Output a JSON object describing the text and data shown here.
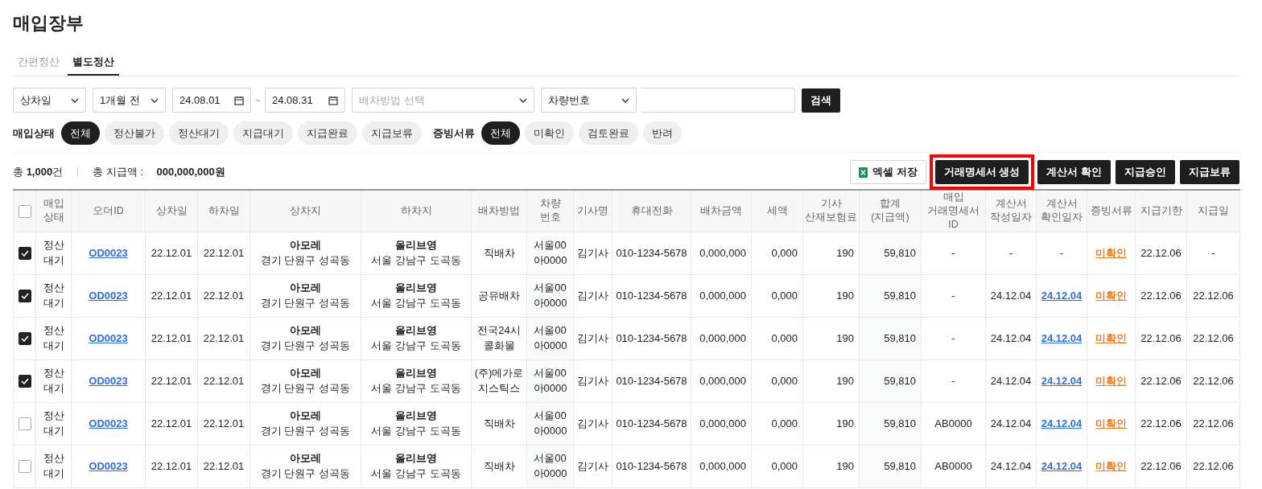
{
  "title": "매입장부",
  "tabs": [
    {
      "label": "간편정산",
      "selected": false
    },
    {
      "label": "별도정산",
      "selected": true
    }
  ],
  "filters": {
    "date_type": "상차일",
    "period": "1개월 전",
    "date_from": "24.08.01",
    "date_sep": "~",
    "date_to": "24.08.31",
    "dispatch_placeholder": "배차방법 선택",
    "search_type": "차량번호",
    "search_button": "검색"
  },
  "status_filter": {
    "label": "매입상태",
    "chips": [
      {
        "label": "전체",
        "selected": true
      },
      {
        "label": "정산불가",
        "selected": false
      },
      {
        "label": "정산대기",
        "selected": false
      },
      {
        "label": "지급대기",
        "selected": false
      },
      {
        "label": "지급완료",
        "selected": false
      },
      {
        "label": "지급보류",
        "selected": false
      }
    ]
  },
  "doc_filter": {
    "label": "증빙서류",
    "chips": [
      {
        "label": "전체",
        "selected": true
      },
      {
        "label": "미확인",
        "selected": false
      },
      {
        "label": "검토완료",
        "selected": false
      },
      {
        "label": "반려",
        "selected": false
      }
    ]
  },
  "summary": {
    "count": "총 **1,000**건",
    "total_label": "총 지급액 :",
    "total_value": "000,000,000원"
  },
  "actions": [
    {
      "label": "엑셀 저장",
      "kind": "excel",
      "highlighted": false
    },
    {
      "label": "거래명세서 생성",
      "kind": "dark",
      "highlighted": true
    },
    {
      "label": "계산서 확인",
      "kind": "dark",
      "highlighted": false
    },
    {
      "label": "지급승인",
      "kind": "dark",
      "highlighted": false
    },
    {
      "label": "지급보류",
      "kind": "dark",
      "highlighted": false
    }
  ],
  "table": {
    "all_checked": false,
    "columns": [
      "매입\n상태",
      "오더ID",
      "상차일",
      "하차일",
      "상차지",
      "하차지",
      "배차방법",
      "차량\n번호",
      "기사명",
      "휴대전화",
      "배차금액",
      "세액",
      "기사\n산재보험료",
      "합계\n(지급액)",
      "매입\n거래명세서ID",
      "계산서\n작성일자",
      "계산서\n확인일자",
      "증빙서류",
      "지급기한",
      "지급일"
    ],
    "rows": [
      {
        "checked": true,
        "status": "정산\n대기",
        "order_id": "OD0023",
        "load_date": "22.12.01",
        "unload_date": "22.12.01",
        "pickup": {
          "name": "아모레",
          "address": "경기 단원구 성곡동"
        },
        "dropoff": {
          "name": "올리브영",
          "address": "서울 강남구 도곡동"
        },
        "dispatch": "직배차",
        "vehicle": "서울00\n아0000",
        "driver": "김기사",
        "phone": "010-1234-5678",
        "amount": "0,000,000",
        "tax": "0,000",
        "insurance": "190",
        "total": "59,810",
        "invoice_id": "-",
        "issue_date": "-",
        "confirm_date": "-",
        "confirmed": false,
        "doc_status": "미확인",
        "due_date": "22.12.06",
        "pay_date": "-"
      },
      {
        "checked": true,
        "status": "정산\n대기",
        "order_id": "OD0023",
        "load_date": "22.12.01",
        "unload_date": "22.12.01",
        "pickup": {
          "name": "아모레",
          "address": "경기 단원구 성곡동"
        },
        "dropoff": {
          "name": "올리브영",
          "address": "서울 강남구 도곡동"
        },
        "dispatch": "공유배차",
        "vehicle": "서울00\n아0000",
        "driver": "김기사",
        "phone": "010-1234-5678",
        "amount": "0,000,000",
        "tax": "0,000",
        "insurance": "190",
        "total": "59,810",
        "invoice_id": "-",
        "issue_date": "24.12.04",
        "confirm_date": "24.12.04",
        "confirmed": true,
        "doc_status": "미확인",
        "due_date": "22.12.06",
        "pay_date": "22.12.06"
      },
      {
        "checked": true,
        "status": "정산\n대기",
        "order_id": "OD0023",
        "load_date": "22.12.01",
        "unload_date": "22.12.01",
        "pickup": {
          "name": "아모레",
          "address": "경기 단원구 성곡동"
        },
        "dropoff": {
          "name": "올리브영",
          "address": "서울 강남구 도곡동"
        },
        "dispatch": "전국24시\n콜화물",
        "vehicle": "서울00\n아0000",
        "driver": "김기사",
        "phone": "010-1234-5678",
        "amount": "0,000,000",
        "tax": "0,000",
        "insurance": "190",
        "total": "59,810",
        "invoice_id": "-",
        "issue_date": "24.12.04",
        "confirm_date": "24.12.04",
        "confirmed": true,
        "doc_status": "미확인",
        "due_date": "22.12.06",
        "pay_date": "22.12.06"
      },
      {
        "checked": true,
        "status": "정산\n대기",
        "order_id": "OD0023",
        "load_date": "22.12.01",
        "unload_date": "22.12.01",
        "pickup": {
          "name": "아모레",
          "address": "경기 단원구 성곡동"
        },
        "dropoff": {
          "name": "올리브영",
          "address": "서울 강남구 도곡동"
        },
        "dispatch": "(주)메가로\n지스틱스",
        "vehicle": "서울00\n아0000",
        "driver": "김기사",
        "phone": "010-1234-5678",
        "amount": "0,000,000",
        "tax": "0,000",
        "insurance": "190",
        "total": "59,810",
        "invoice_id": "-",
        "issue_date": "24.12.04",
        "confirm_date": "24.12.04",
        "confirmed": true,
        "doc_status": "미확인",
        "due_date": "22.12.06",
        "pay_date": "22.12.06"
      },
      {
        "checked": false,
        "status": "정산\n대기",
        "order_id": "OD0023",
        "load_date": "22.12.01",
        "unload_date": "22.12.01",
        "pickup": {
          "name": "아모레",
          "address": "경기 단원구 성곡동"
        },
        "dropoff": {
          "name": "올리브영",
          "address": "서울 강남구 도곡동"
        },
        "dispatch": "직배차",
        "vehicle": "서울00\n아0000",
        "driver": "김기사",
        "phone": "010-1234-5678",
        "amount": "0,000,000",
        "tax": "0,000",
        "insurance": "190",
        "total": "59,810",
        "invoice_id": "AB0000",
        "issue_date": "24.12.04",
        "confirm_date": "24.12.04",
        "confirmed": true,
        "doc_status": "미확인",
        "due_date": "22.12.06",
        "pay_date": "22.12.06"
      },
      {
        "checked": false,
        "status": "정산\n대기",
        "order_id": "OD0023",
        "load_date": "22.12.01",
        "unload_date": "22.12.01",
        "pickup": {
          "name": "아모레",
          "address": "경기 단원구 성곡동"
        },
        "dropoff": {
          "name": "올리브영",
          "address": "서울 강남구 도곡동"
        },
        "dispatch": "직배차",
        "vehicle": "서울00\n아0000",
        "driver": "김기사",
        "phone": "010-1234-5678",
        "amount": "0,000,000",
        "tax": "0,000",
        "insurance": "190",
        "total": "59,810",
        "invoice_id": "AB0000",
        "issue_date": "24.12.04",
        "confirm_date": "24.12.04",
        "confirmed": true,
        "doc_status": "미확인",
        "due_date": "22.12.06",
        "pay_date": "22.12.06"
      }
    ]
  }
}
